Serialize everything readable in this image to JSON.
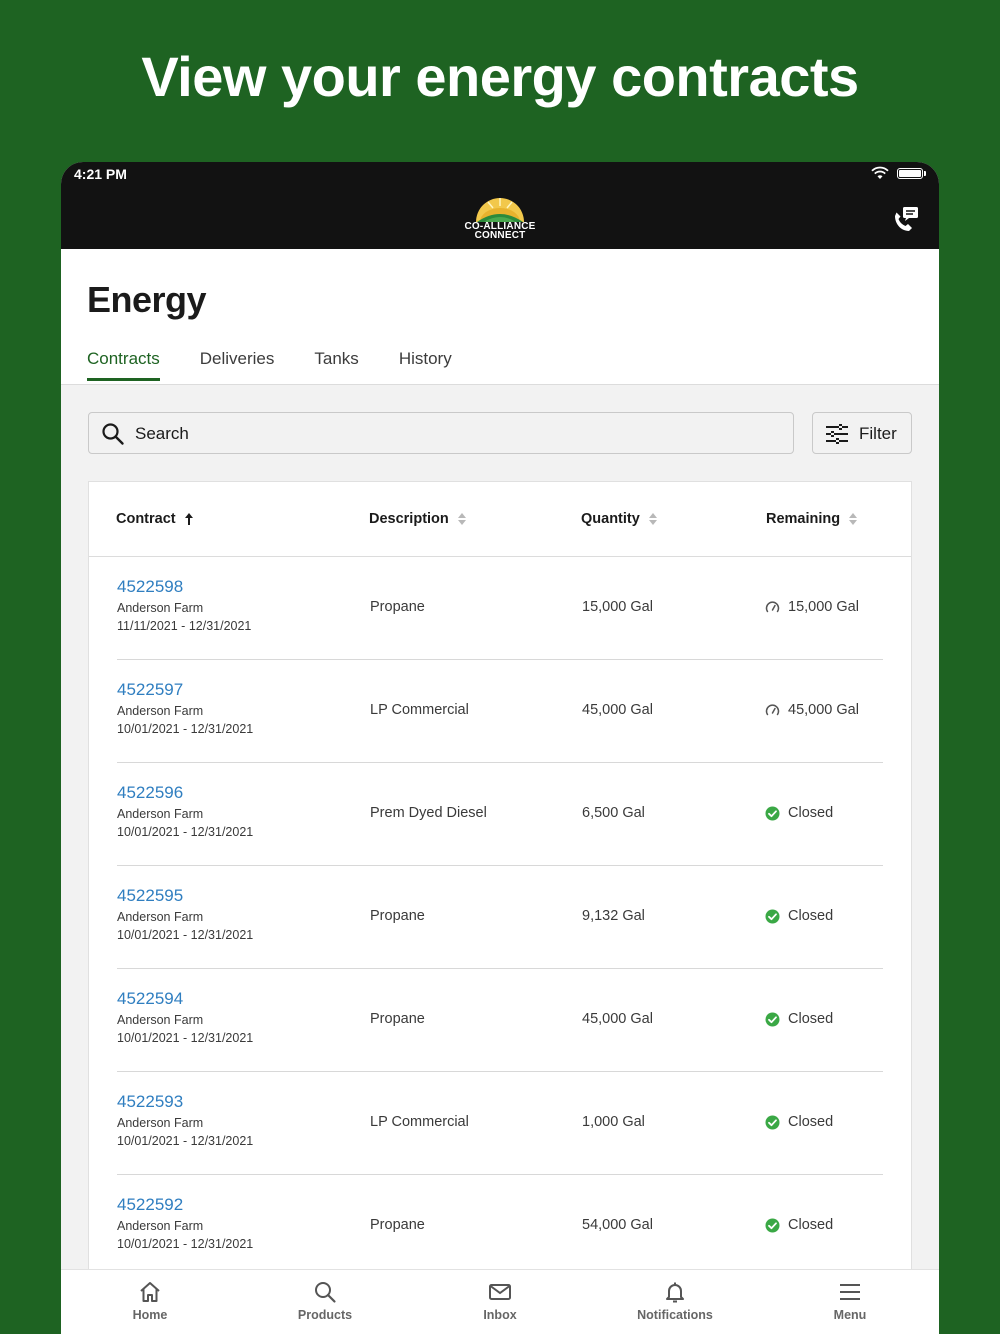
{
  "hero": {
    "title": "View your energy contracts"
  },
  "status_bar": {
    "time": "4:21 PM"
  },
  "brand": {
    "line1": "CO-ALLIANCE",
    "line2": "CONNECT"
  },
  "header": {
    "title": "Energy"
  },
  "tabs": [
    {
      "label": "Contracts",
      "active": true
    },
    {
      "label": "Deliveries"
    },
    {
      "label": "Tanks"
    },
    {
      "label": "History"
    }
  ],
  "search": {
    "placeholder": "Search"
  },
  "filter": {
    "label": "Filter"
  },
  "table": {
    "columns": [
      "Contract",
      "Description",
      "Quantity",
      "Remaining"
    ],
    "rows": [
      {
        "contract": "4522598",
        "farm": "Anderson Farm",
        "dates": "11/11/2021 - 12/31/2021",
        "description": "Propane",
        "quantity": "15,000 Gal",
        "remaining": "15,000 Gal",
        "status": "gauge"
      },
      {
        "contract": "4522597",
        "farm": "Anderson Farm",
        "dates": "10/01/2021 - 12/31/2021",
        "description": "LP Commercial",
        "quantity": "45,000 Gal",
        "remaining": "45,000 Gal",
        "status": "gauge"
      },
      {
        "contract": "4522596",
        "farm": "Anderson Farm",
        "dates": "10/01/2021 - 12/31/2021",
        "description": "Prem Dyed Diesel",
        "quantity": "6,500 Gal",
        "remaining": "Closed",
        "status": "closed"
      },
      {
        "contract": "4522595",
        "farm": "Anderson Farm",
        "dates": "10/01/2021 - 12/31/2021",
        "description": "Propane",
        "quantity": "9,132 Gal",
        "remaining": "Closed",
        "status": "closed"
      },
      {
        "contract": "4522594",
        "farm": "Anderson Farm",
        "dates": "10/01/2021 - 12/31/2021",
        "description": "Propane",
        "quantity": "45,000 Gal",
        "remaining": "Closed",
        "status": "closed"
      },
      {
        "contract": "4522593",
        "farm": "Anderson Farm",
        "dates": "10/01/2021 - 12/31/2021",
        "description": "LP Commercial",
        "quantity": "1,000 Gal",
        "remaining": "Closed",
        "status": "closed"
      },
      {
        "contract": "4522592",
        "farm": "Anderson Farm",
        "dates": "10/01/2021 - 12/31/2021",
        "description": "Propane",
        "quantity": "54,000 Gal",
        "remaining": "Closed",
        "status": "closed"
      }
    ]
  },
  "nav": [
    {
      "label": "Home",
      "icon": "home-icon"
    },
    {
      "label": "Products",
      "icon": "search-icon"
    },
    {
      "label": "Inbox",
      "icon": "mail-icon"
    },
    {
      "label": "Notifications",
      "icon": "bell-icon"
    },
    {
      "label": "Menu",
      "icon": "menu-icon"
    }
  ],
  "colors": {
    "brand_green": "#1e6322",
    "link_blue": "#2f7ec0",
    "closed_green": "#3aa845",
    "topbar": "#121212"
  }
}
